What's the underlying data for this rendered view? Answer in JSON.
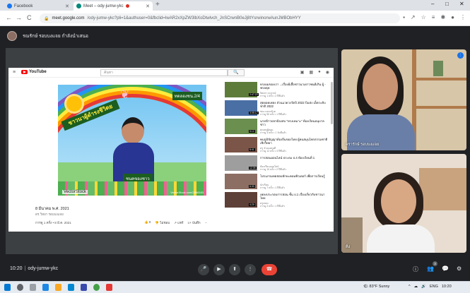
{
  "browser": {
    "tabs": [
      {
        "label": "Facebook",
        "active": false,
        "favicon_color": "#1877f2"
      },
      {
        "label": "Meet – ody-jumw-ykc",
        "active": true,
        "favicon_color": "#00897b",
        "recording": true
      }
    ],
    "new_tab": "+",
    "window_controls": {
      "minimize": "–",
      "maximize": "□",
      "close": "✕"
    },
    "url_host": "meet.google.com",
    "url_rest": "/ody-jumw-ykc?pli=1&authuser=0&fbclid=IwAR2xXpZW3lbXoDtwlvch_JnSCrwnB0eJj8tYsrwinorwAunJMBObHYY",
    "nav": {
      "back": "←",
      "forward": "→",
      "reload": "C"
    }
  },
  "meet": {
    "presenter_banner": "รณรักษ์ รอบบงแจย กำลังนำเสนอ",
    "meeting_time": "10:20",
    "meeting_code": "ody-jumw-ykc",
    "participant_count": "3",
    "controls": {
      "mic": "🎤",
      "camera": "▶",
      "present": "⬆",
      "more": "⋮",
      "leave": "☎"
    },
    "right_controls": {
      "info": "ⓘ",
      "people": "👥",
      "chat": "💬",
      "activities": "⚙"
    },
    "participants": [
      {
        "name": "ครารักษ์ รอบบงแจย",
        "badge": "⋮"
      },
      {
        "name": "คิ่ง"
      }
    ]
  },
  "youtube": {
    "logo_text": "YouTube",
    "search_placeholder": "ค้นหา",
    "search_button": "🔍",
    "video": {
      "banner_text": "ชาวนาผู้ดำรงชีวิตย",
      "top_label": "ทดลองชน.2/4",
      "bottom_label": "ชนคของชาว",
      "watermark": "VectorStock",
      "watermark_url": "VectorStock.com/2868183",
      "date": "8 มีนาคม พ.ศ. 2021",
      "channel": "ดร.วิทยา รอบบงแจย",
      "desc": "การดู 1 ครั้ง • 8 มี.ค. 2021",
      "actions": [
        "👍 0",
        "👎 ไม่ชอบ",
        "↗ แชร์",
        "≡+ บันทึก",
        "..."
      ]
    },
    "suggestions": [
      {
        "title": "ทรงผมของเรา ...เรื่องผีเสื้อชาวนาเยาวชนดีเกิน ผู้ - ฟรอดุด",
        "channel": "จิตตรา สุวรรณ์",
        "meta": "การดู 1 ครั้ง • 2 ปีที่แล้ว",
        "duration": "2:47:23",
        "color": "#5d7c3a"
      },
      {
        "title": "สุดยอดเพลง ส่วนแวดวงวัดปี 2022 ปีแห่ง เด็ดระดับชาติ 2022",
        "channel": "ช่อง กอดกล้วย",
        "meta": "การดู 50 ครั้ง • 1 ปีที่แล้ว",
        "duration": "3:05:12",
        "color": "#4a6fa5"
      },
      {
        "title": "นายข้าวปลาต้องสบ \"ทรงเหมาะ\" ห้องเรียนอนุบาลชาว",
        "channel": "คุณครูผู้สอน",
        "meta": "การดู 3 ครั้ง • 1 วันที่แล้ว",
        "duration": "5:12",
        "color": "#6a8f4e"
      },
      {
        "title": "พบภูมิปัญญาท้องถิ่นของไทย ผู้คนสมุนไพรธรรมชาติเชิงวิทยา",
        "channel": "ครู จำลองคนดี",
        "meta": "การดู 12 ครั้ง • 3 ปีที่แล้ว",
        "duration": "8:41",
        "color": "#7a5548"
      },
      {
        "title": "การสอนออนไลน์ ประถม ป.4 ห้องเรียนที่ 1",
        "channel": "ห้องเรียนออนไลน์",
        "meta": "การดู 10 ครั้ง • 2 ปีที่แล้ว",
        "duration": "12:05",
        "color": "#9e9e9e"
      },
      {
        "title": "โปรแกรมทดสอบทักษะคอมพิวเตอร์ เพื่อการเรียนรู้",
        "channel": "นักเรียน",
        "meta": "การดู 7 ครั้ง • 1 ปีที่แล้ว",
        "duration": "6:33",
        "color": "#8d6e63"
      },
      {
        "title": "เพลงประกอบการสอน ชั้น ป.1 เรื่องเกี่ยวกับชาวนาไทย",
        "channel": "ครูเพลง",
        "meta": "การดู 2 ครั้ง • 1 ปีที่แล้ว",
        "duration": "4:20",
        "color": "#5d4037"
      }
    ]
  },
  "taskbar": {
    "weather": "🌤 83°F Sunny",
    "tray": [
      "^",
      "☁",
      "🔊",
      "ENG",
      "10:20"
    ]
  }
}
